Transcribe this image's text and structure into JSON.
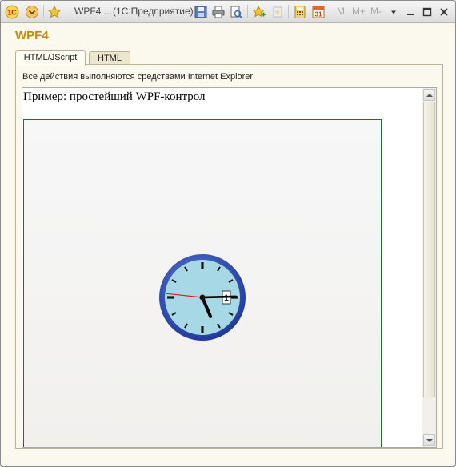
{
  "window": {
    "title": "WPF4 ...",
    "app": "(1С:Предприятие)",
    "icons": [
      "1c-logo-icon",
      "menu-icon",
      "favorites-star-icon",
      "save-icon",
      "print-icon",
      "print-preview-icon",
      "add-favorite-icon",
      "history-icon",
      "calculator-icon",
      "calendar-icon",
      "dropdown-icon",
      "minimize-icon",
      "maximize-icon",
      "close-icon"
    ],
    "calendar_day": "31",
    "memory": {
      "m": "M",
      "mplus": "M+",
      "mminus": "M-"
    }
  },
  "form": {
    "title": "WPF4",
    "tabs": [
      {
        "label": "HTML/JScript",
        "active": true
      },
      {
        "label": "HTML",
        "active": false
      }
    ],
    "note": "Все действия выполняются средствами Internet Explorer"
  },
  "browser": {
    "page_heading": "Пример: простейший WPF-контрол",
    "clock": {
      "hour": 5,
      "minute": 14,
      "second": 46,
      "date_label": "1",
      "face_color": "#a6d8e6",
      "rim_color": "#2b4db0",
      "second_hand_color": "#e02020"
    }
  },
  "colors": {
    "heading": "#c08c0f",
    "wpf_border": "#0d7a2a"
  }
}
